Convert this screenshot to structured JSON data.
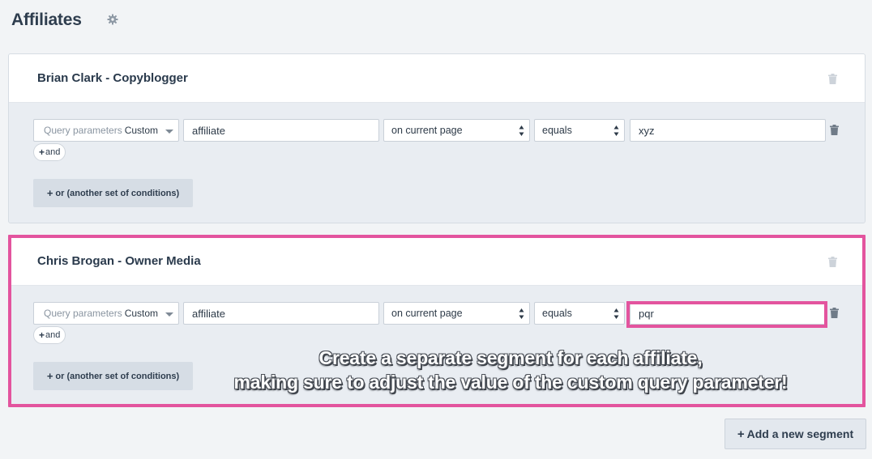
{
  "page": {
    "title": "Affiliates",
    "settings_icon": "gear-icon"
  },
  "segments": [
    {
      "name": "Brian Clark - Copyblogger",
      "condition": {
        "param_type_placeholder": "Query parameters",
        "param_type_value": "Custom",
        "key": "affiliate",
        "scope": "on current page",
        "operator": "equals",
        "value": "xyz"
      },
      "and_label": "and",
      "or_label": "or (another set of conditions)"
    },
    {
      "name": "Chris Brogan - Owner Media",
      "condition": {
        "param_type_placeholder": "Query parameters",
        "param_type_value": "Custom",
        "key": "affiliate",
        "scope": "on current page",
        "operator": "equals",
        "value": "pqr"
      },
      "and_label": "and",
      "or_label": "or (another set of conditions)"
    }
  ],
  "annotation": {
    "line1": "Create a separate segment for each affiliate,",
    "line2": "making sure to adjust the value of the custom query parameter!",
    "highlight_color": "#e3549e"
  },
  "add_segment_label": "Add a new segment",
  "plus_glyph": "+"
}
